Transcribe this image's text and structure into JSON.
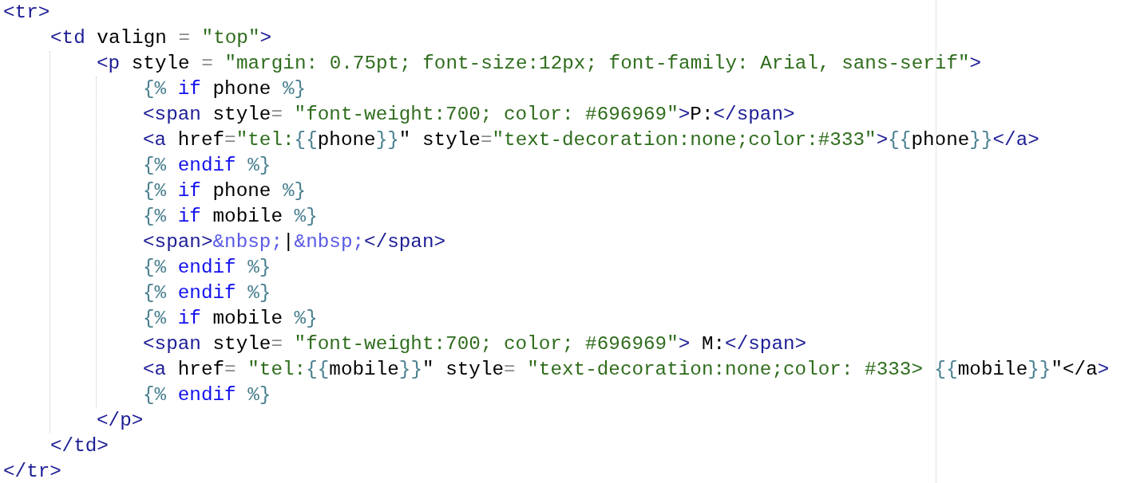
{
  "editor": {
    "lines": [
      {
        "tokens": [
          {
            "kind": "tag",
            "text": "<tr>"
          }
        ],
        "children": [
          {
            "tokens": [
              {
                "kind": "tag",
                "text": "<td"
              },
              {
                "kind": "attr",
                "text": " valign "
              },
              {
                "kind": "eq",
                "text": "= "
              },
              {
                "kind": "str",
                "text": "\"top\""
              },
              {
                "kind": "tag",
                "text": ">"
              }
            ],
            "children": [
              {
                "tokens": [
                  {
                    "kind": "tag",
                    "text": "<p"
                  },
                  {
                    "kind": "attr",
                    "text": " style "
                  },
                  {
                    "kind": "eq",
                    "text": "= "
                  },
                  {
                    "kind": "str",
                    "text": "\"margin: 0.75pt; font-size:12px; font-family: Arial, sans-serif\""
                  },
                  {
                    "kind": "tag",
                    "text": ">"
                  }
                ],
                "children": [
                  {
                    "tokens": [
                      {
                        "kind": "tpl",
                        "text": "{% "
                      },
                      {
                        "kind": "kw",
                        "text": "if"
                      },
                      {
                        "kind": "txt",
                        "text": " phone "
                      },
                      {
                        "kind": "tpl",
                        "text": "%}"
                      }
                    ]
                  },
                  {
                    "tokens": [
                      {
                        "kind": "tag",
                        "text": "<span"
                      },
                      {
                        "kind": "attr",
                        "text": " style"
                      },
                      {
                        "kind": "eq",
                        "text": "= "
                      },
                      {
                        "kind": "str",
                        "text": "\"font-weight:700; color: #696969\""
                      },
                      {
                        "kind": "tag",
                        "text": ">"
                      },
                      {
                        "kind": "txt",
                        "text": "P:"
                      },
                      {
                        "kind": "tag",
                        "text": "</span>"
                      }
                    ]
                  },
                  {
                    "tokens": [
                      {
                        "kind": "tag",
                        "text": "<a"
                      },
                      {
                        "kind": "attr",
                        "text": " href"
                      },
                      {
                        "kind": "eq",
                        "text": "="
                      },
                      {
                        "kind": "str",
                        "text": "\"tel:"
                      },
                      {
                        "kind": "tpl",
                        "text": "{{"
                      },
                      {
                        "kind": "txt",
                        "text": "phone"
                      },
                      {
                        "kind": "tpl",
                        "text": "}}"
                      },
                      {
                        "kind": "txt",
                        "text": "\" style"
                      },
                      {
                        "kind": "eq",
                        "text": "="
                      },
                      {
                        "kind": "str",
                        "text": "\"text-decoration:none;color:#333\""
                      },
                      {
                        "kind": "tag",
                        "text": ">"
                      },
                      {
                        "kind": "tpl",
                        "text": "{{"
                      },
                      {
                        "kind": "txt",
                        "text": "phone"
                      },
                      {
                        "kind": "tpl",
                        "text": "}}"
                      },
                      {
                        "kind": "tag",
                        "text": "</a>"
                      }
                    ]
                  },
                  {
                    "tokens": [
                      {
                        "kind": "tpl",
                        "text": "{% "
                      },
                      {
                        "kind": "kw",
                        "text": "endif"
                      },
                      {
                        "kind": "tpl",
                        "text": " %}"
                      }
                    ]
                  },
                  {
                    "tokens": [
                      {
                        "kind": "tpl",
                        "text": "{% "
                      },
                      {
                        "kind": "kw",
                        "text": "if"
                      },
                      {
                        "kind": "txt",
                        "text": " phone "
                      },
                      {
                        "kind": "tpl",
                        "text": "%}"
                      }
                    ]
                  },
                  {
                    "tokens": [
                      {
                        "kind": "tpl",
                        "text": "{% "
                      },
                      {
                        "kind": "kw",
                        "text": "if"
                      },
                      {
                        "kind": "txt",
                        "text": " mobile "
                      },
                      {
                        "kind": "tpl",
                        "text": "%}"
                      }
                    ]
                  },
                  {
                    "tokens": [
                      {
                        "kind": "tag",
                        "text": "<span>"
                      },
                      {
                        "kind": "ent",
                        "text": "&nbsp;"
                      },
                      {
                        "kind": "txt",
                        "text": "|"
                      },
                      {
                        "kind": "ent",
                        "text": "&nbsp;"
                      },
                      {
                        "kind": "tag",
                        "text": "</span>"
                      }
                    ]
                  },
                  {
                    "tokens": [
                      {
                        "kind": "tpl",
                        "text": "{% "
                      },
                      {
                        "kind": "kw",
                        "text": "endif"
                      },
                      {
                        "kind": "tpl",
                        "text": " %}"
                      }
                    ]
                  },
                  {
                    "tokens": [
                      {
                        "kind": "tpl",
                        "text": "{% "
                      },
                      {
                        "kind": "kw",
                        "text": "endif"
                      },
                      {
                        "kind": "tpl",
                        "text": " %}"
                      }
                    ]
                  },
                  {
                    "tokens": [
                      {
                        "kind": "tpl",
                        "text": "{% "
                      },
                      {
                        "kind": "kw",
                        "text": "if"
                      },
                      {
                        "kind": "txt",
                        "text": " mobile "
                      },
                      {
                        "kind": "tpl",
                        "text": "%}"
                      }
                    ]
                  },
                  {
                    "tokens": [
                      {
                        "kind": "tag",
                        "text": "<span"
                      },
                      {
                        "kind": "attr",
                        "text": " style"
                      },
                      {
                        "kind": "eq",
                        "text": "= "
                      },
                      {
                        "kind": "str",
                        "text": "\"font-weight:700; color; #696969\""
                      },
                      {
                        "kind": "tag",
                        "text": ">"
                      },
                      {
                        "kind": "txt",
                        "text": " M:"
                      },
                      {
                        "kind": "tag",
                        "text": "</span>"
                      }
                    ]
                  },
                  {
                    "tokens": [
                      {
                        "kind": "tag",
                        "text": "<a"
                      },
                      {
                        "kind": "attr",
                        "text": " href"
                      },
                      {
                        "kind": "eq",
                        "text": "= "
                      },
                      {
                        "kind": "str",
                        "text": "\"tel:"
                      },
                      {
                        "kind": "tpl",
                        "text": "{{"
                      },
                      {
                        "kind": "txt",
                        "text": "mobile"
                      },
                      {
                        "kind": "tpl",
                        "text": "}}"
                      },
                      {
                        "kind": "txt",
                        "text": "\" style"
                      },
                      {
                        "kind": "eq",
                        "text": "= "
                      },
                      {
                        "kind": "str",
                        "text": "\"text-decoration:none;color: #333> "
                      },
                      {
                        "kind": "tpl",
                        "text": "{{"
                      },
                      {
                        "kind": "txt",
                        "text": "mobile"
                      },
                      {
                        "kind": "tpl",
                        "text": "}}"
                      },
                      {
                        "kind": "txt",
                        "text": "\"</a"
                      },
                      {
                        "kind": "tag",
                        "text": ">"
                      }
                    ]
                  },
                  {
                    "tokens": [
                      {
                        "kind": "tpl",
                        "text": "{% "
                      },
                      {
                        "kind": "kw",
                        "text": "endif"
                      },
                      {
                        "kind": "tpl",
                        "text": " %}"
                      }
                    ]
                  }
                ]
              },
              {
                "tokens": [
                  {
                    "kind": "tag",
                    "text": "</p>"
                  }
                ]
              }
            ]
          },
          {
            "tokens": [
              {
                "kind": "tag",
                "text": "</td>"
              }
            ]
          }
        ]
      },
      {
        "tokens": [
          {
            "kind": "tag",
            "text": "</tr>"
          }
        ]
      }
    ]
  }
}
